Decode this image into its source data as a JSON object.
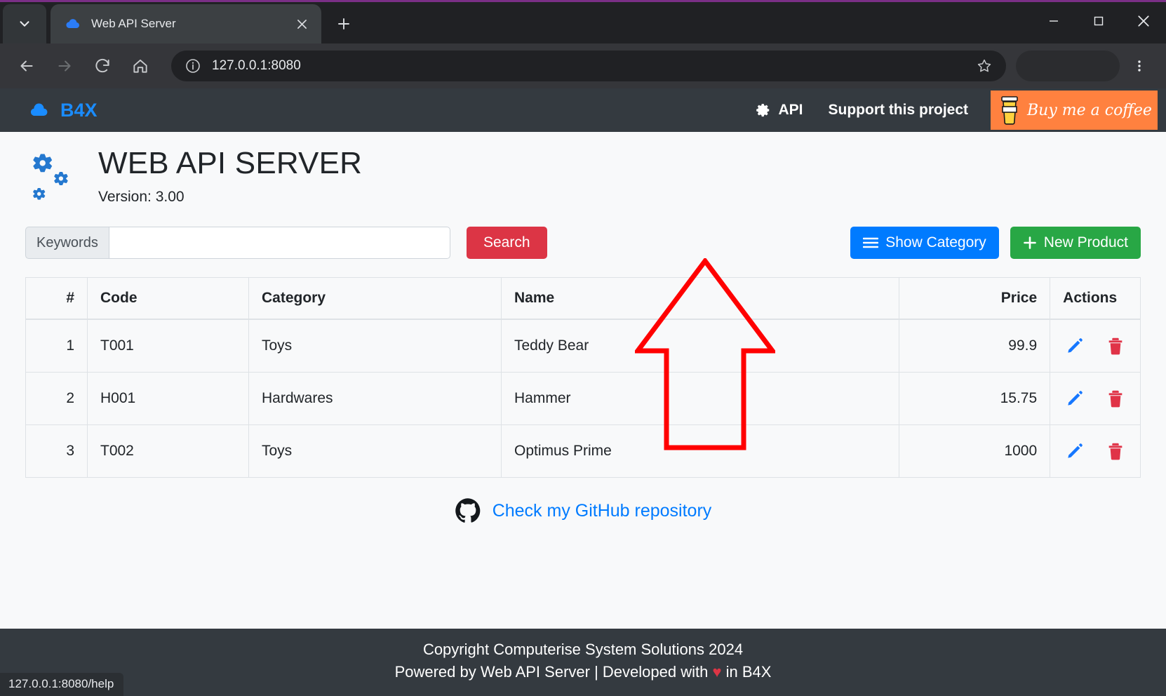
{
  "browser": {
    "tab": {
      "title": "Web API Server",
      "favicon": "cloud-icon"
    },
    "tab_list_icon": "chevron-down-icon",
    "new_tab_icon": "plus-icon",
    "close_icon": "close-icon",
    "window_controls": {
      "minimize": "minimize-icon",
      "maximize": "maximize-icon",
      "close": "close-icon"
    },
    "nav": {
      "back": "back-arrow-icon",
      "forward": "forward-arrow-icon",
      "reload": "reload-icon",
      "home": "home-icon"
    },
    "omnibox": {
      "url": "127.0.0.1:8080",
      "info_icon": "info-circle-icon",
      "star_icon": "star-icon"
    },
    "menu_icon": "kebab-menu-icon",
    "status_bubble": "127.0.0.1:8080/help"
  },
  "navbar": {
    "brand": "B4X",
    "brand_icon": "cloud-icon",
    "api_link": "API",
    "api_icon": "gear-icon",
    "support_link": "Support this project",
    "coffee_button": "Buy me a coffee",
    "coffee_icon": "coffee-cup-icon",
    "background": "#343a40",
    "brand_color": "#1a8cff",
    "coffee_color": "#ff813f"
  },
  "page": {
    "logo_icon": "gears-icon",
    "title": "WEB API SERVER",
    "version": "Version: 3.00"
  },
  "search": {
    "label": "Keywords",
    "value": "",
    "placeholder": "",
    "button": "Search",
    "button_color": "#dc3545"
  },
  "actions": {
    "show_category": "Show Category",
    "show_category_icon": "hamburger-icon",
    "show_category_color": "#007bff",
    "new_product": "New Product",
    "new_product_icon": "plus-icon",
    "new_product_color": "#28a745"
  },
  "table": {
    "headers": [
      "#",
      "Code",
      "Category",
      "Name",
      "Price",
      "Actions"
    ],
    "rows": [
      {
        "num": "1",
        "code": "T001",
        "category": "Toys",
        "name": "Teddy Bear",
        "price": "99.9"
      },
      {
        "num": "2",
        "code": "H001",
        "category": "Hardwares",
        "name": "Hammer",
        "price": "15.75"
      },
      {
        "num": "3",
        "code": "T002",
        "category": "Toys",
        "name": "Optimus Prime",
        "price": "1000"
      }
    ],
    "edit_icon": "pencil-icon",
    "delete_icon": "trash-icon",
    "edit_color": "#007bff",
    "delete_color": "#dc3545"
  },
  "github": {
    "icon": "github-icon",
    "label": "Check my GitHub repository",
    "color": "#007bff"
  },
  "footer": {
    "line1": "Copyright Computerise System Solutions 2024",
    "line2_before": "Powered by Web API Server | Developed with ",
    "line2_heart": "♥",
    "line2_after": " in B4X",
    "background": "#343a40"
  },
  "annotation": {
    "shape": "up-arrow",
    "color": "#ff0000"
  }
}
